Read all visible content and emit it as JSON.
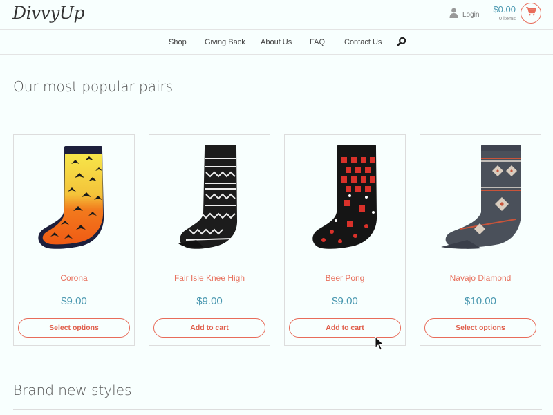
{
  "header": {
    "logo": "DivvyUp",
    "login_label": "Login",
    "cart_total": "$0.00",
    "cart_count": "0 items"
  },
  "nav": {
    "items": [
      "Shop",
      "Giving Back",
      "About Us",
      "FAQ",
      "Contact Us"
    ]
  },
  "sections": {
    "popular_title": "Our most popular pairs",
    "new_title": "Brand new styles"
  },
  "products": [
    {
      "name": "Corona",
      "price": "$9.00",
      "button": "Select options",
      "image": "palm-tree-sock"
    },
    {
      "name": "Fair Isle Knee High",
      "price": "$9.00",
      "button": "Add to cart",
      "image": "fair-isle-sock"
    },
    {
      "name": "Beer Pong",
      "price": "$9.00",
      "button": "Add to cart",
      "image": "red-cup-sock"
    },
    {
      "name": "Navajo Diamond",
      "price": "$10.00",
      "button": "Select options",
      "image": "navajo-sock"
    }
  ],
  "colors": {
    "accent": "#e86c5a",
    "price": "#4a98b0",
    "background": "#f8fffe"
  },
  "icons": [
    "user-icon",
    "cart-icon",
    "search-icon",
    "mouse-pointer-icon"
  ]
}
